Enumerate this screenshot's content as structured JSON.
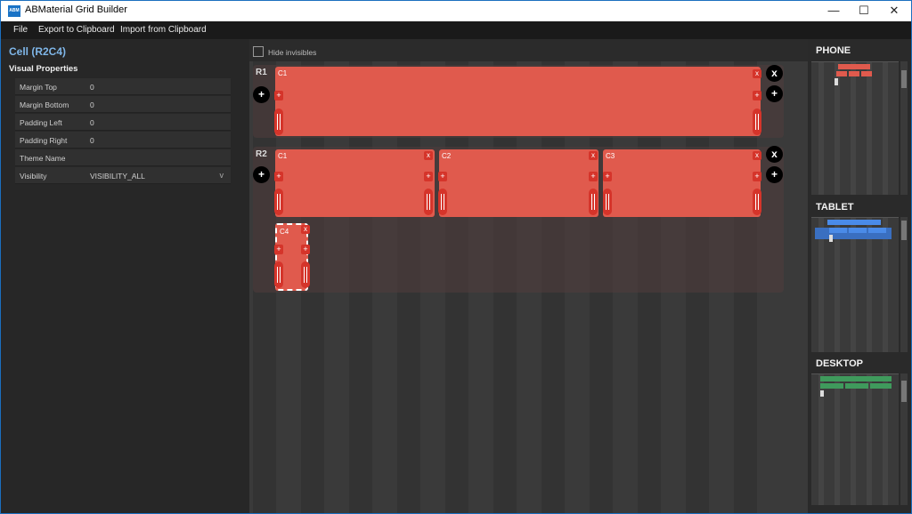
{
  "window": {
    "title": "ABMaterial Grid Builder",
    "minimize": "—",
    "maximize": "☐",
    "close": "✕"
  },
  "menu": {
    "file": "File",
    "export": "Export to Clipboard",
    "import": "Import from Clipboard"
  },
  "left": {
    "cell_title": "Cell (R2C4)",
    "section_title": "Visual Properties",
    "props": [
      {
        "label": "Margin Top",
        "value": "0"
      },
      {
        "label": "Margin Bottom",
        "value": "0"
      },
      {
        "label": "Padding Left",
        "value": "0"
      },
      {
        "label": "Padding Right",
        "value": "0"
      },
      {
        "label": "Theme Name",
        "value": ""
      },
      {
        "label": "Visibility",
        "value": "VISIBILITY_ALL"
      }
    ]
  },
  "center": {
    "hide_invisibles": "Hide invisibles",
    "rows": [
      {
        "label": "R1",
        "cells": [
          "C1"
        ]
      },
      {
        "label": "R2",
        "cells": [
          "C1",
          "C2",
          "C3",
          "C4"
        ]
      }
    ],
    "cell_remove": "x",
    "cell_add": "+",
    "row_remove": "x",
    "row_add": "+"
  },
  "devices": {
    "phone": "PHONE",
    "tablet": "TABLET",
    "desktop": "DESKTOP"
  },
  "colors": {
    "cell": "#e05a4d",
    "phone": "#e05a4d",
    "tablet": "#4a8be8",
    "desktop": "#3f9a5c",
    "accent": "#7fb6e8"
  }
}
